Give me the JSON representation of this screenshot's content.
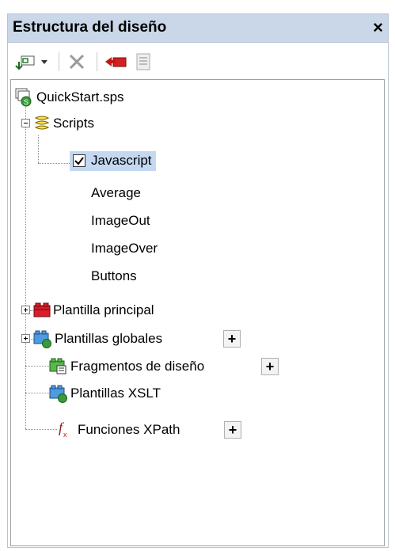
{
  "panel": {
    "title": "Estructura del diseño",
    "close_glyph": "×"
  },
  "toolbar": {
    "icons": [
      "add-dropdown-icon",
      "delete-icon",
      "remove-icon",
      "properties-icon"
    ]
  },
  "tree": {
    "root": "QuickStart.sps",
    "scripts": "Scripts",
    "javascript": "Javascript",
    "scripts_children": [
      "Average",
      "ImageOut",
      "ImageOver",
      "Buttons"
    ],
    "main_template": "Plantilla principal",
    "global_templates": "Plantillas globales",
    "design_fragments": "Fragmentos de diseño",
    "xslt_templates": "Plantillas XSLT",
    "xpath_functions": "Funciones XPath",
    "add_glyph": "+"
  },
  "colors": {
    "title_bg": "#c9d7e8",
    "selection_bg": "#c4d8f1"
  }
}
